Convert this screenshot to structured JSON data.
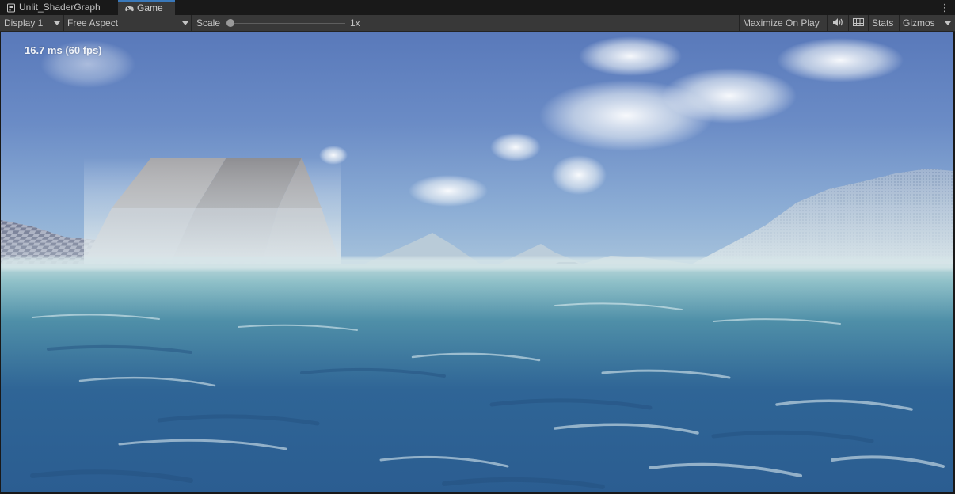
{
  "tabs": [
    {
      "label": "Unlit_ShaderGraph",
      "icon": "shader-graph-icon",
      "active": false
    },
    {
      "label": "Game",
      "icon": "gamepad-icon",
      "active": true
    }
  ],
  "toolbar": {
    "display": "Display 1",
    "aspect": "Free Aspect",
    "scale_label": "Scale",
    "scale_value": "1x",
    "scale_level": 0.0,
    "maximize_on_play": "Maximize On Play",
    "stats": "Stats",
    "gizmos": "Gizmos",
    "mute_icon": "speaker-icon",
    "stats_icon": "grid-icon",
    "menu_icon": "kebab-menu-icon"
  },
  "viewport": {
    "fps_text": "16.7 ms (60 fps)"
  },
  "colors": {
    "accent": "#3a79bb",
    "toolbar_bg": "#383838",
    "tab_bg": "#191919",
    "sky_top": "#5979ba",
    "ocean": "#2f6596"
  }
}
